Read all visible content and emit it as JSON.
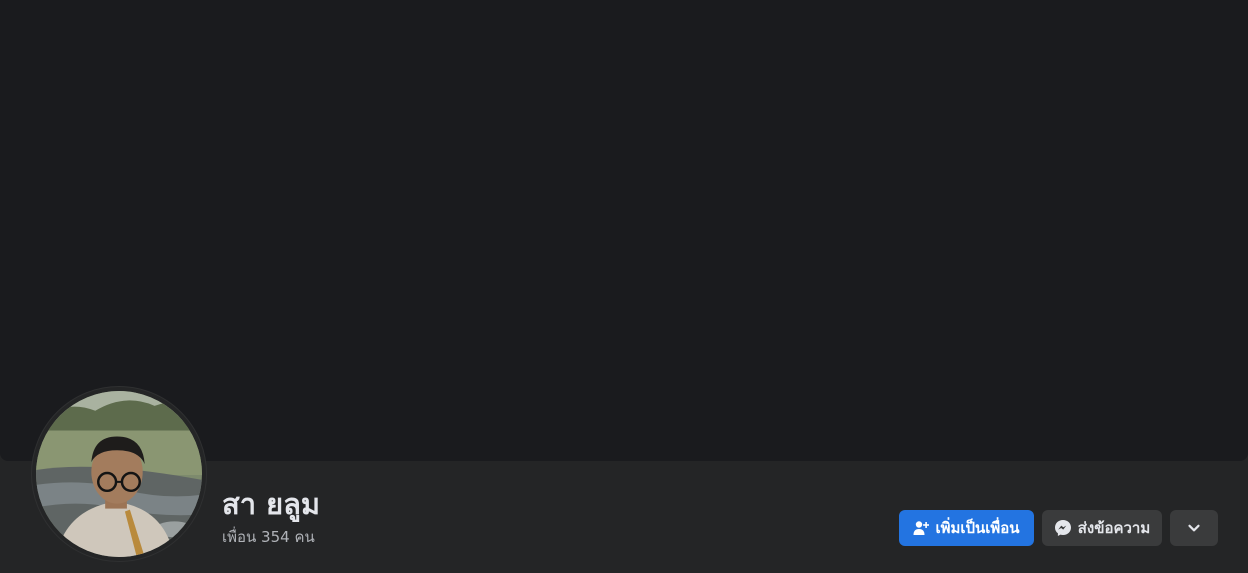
{
  "profile": {
    "name": "สา ยลูม",
    "friends_text": "เพื่อน 354 คน"
  },
  "actions": {
    "add_friend_label": "เพิ่มเป็นเพื่อน",
    "message_label": "ส่งข้อความ"
  },
  "icons": {
    "add_friend": "person-add-icon",
    "message": "messenger-icon",
    "more": "chevron-down-icon"
  },
  "colors": {
    "cover": "#1a1b1e",
    "band": "#242526",
    "primary_button": "#2374e1",
    "secondary_button": "#3a3b3c",
    "name_text": "#e4e6eb",
    "secondary_text": "#b0b3b8"
  }
}
